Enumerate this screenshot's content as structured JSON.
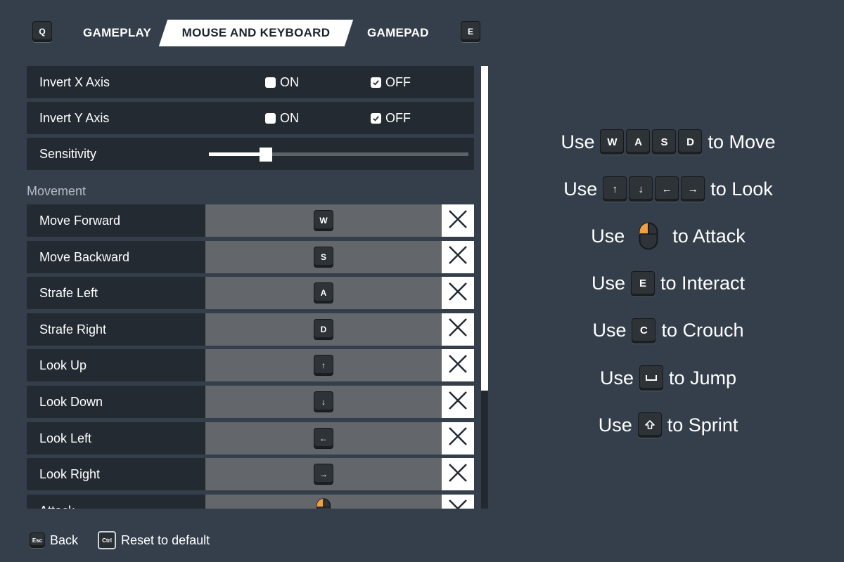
{
  "tabs": {
    "prev_key": "Q",
    "next_key": "E",
    "items": [
      {
        "label": "GAMEPLAY"
      },
      {
        "label": "MOUSE AND KEYBOARD",
        "active": true
      },
      {
        "label": "GAMEPAD"
      }
    ]
  },
  "settings": {
    "invert_x": {
      "label": "Invert X Axis",
      "on_label": "ON",
      "off_label": "OFF",
      "value": "OFF"
    },
    "invert_y": {
      "label": "Invert Y Axis",
      "on_label": "ON",
      "off_label": "OFF",
      "value": "OFF"
    },
    "sensitivity": {
      "label": "Sensitivity",
      "value_fraction": 0.22
    }
  },
  "movement": {
    "section_label": "Movement",
    "bindings": [
      {
        "action": "Move Forward",
        "key": "W",
        "icon": "w-key-icon"
      },
      {
        "action": "Move Backward",
        "key": "S",
        "icon": "s-key-icon"
      },
      {
        "action": "Strafe Left",
        "key": "A",
        "icon": "a-key-icon"
      },
      {
        "action": "Strafe Right",
        "key": "D",
        "icon": "d-key-icon"
      },
      {
        "action": "Look Up",
        "key": "↑",
        "icon": "arrow-up-key-icon"
      },
      {
        "action": "Look Down",
        "key": "↓",
        "icon": "arrow-down-key-icon"
      },
      {
        "action": "Look Left",
        "key": "←",
        "icon": "arrow-left-key-icon"
      },
      {
        "action": "Look Right",
        "key": "→",
        "icon": "arrow-right-key-icon"
      },
      {
        "action": "Attack",
        "key": "",
        "icon": "mouse-left-click-icon"
      }
    ]
  },
  "scroll": {
    "thumb_fraction": 0.733
  },
  "footer": {
    "back_key": "Esc",
    "back_label": "Back",
    "reset_key": "Ctrl",
    "reset_label": "Reset to default"
  },
  "hints": [
    {
      "prefix": "Use",
      "keys": [
        "W",
        "A",
        "S",
        "D"
      ],
      "suffix": "to Move"
    },
    {
      "prefix": "Use",
      "keys": [
        "↑",
        "↓",
        "←",
        "→"
      ],
      "suffix": "to Look"
    },
    {
      "prefix": "Use",
      "keys": [],
      "icon": "mouse-left-click-icon",
      "suffix": "to Attack"
    },
    {
      "prefix": "Use",
      "keys": [
        "E"
      ],
      "suffix": "to Interact"
    },
    {
      "prefix": "Use",
      "keys": [
        "C"
      ],
      "suffix": "to Crouch"
    },
    {
      "prefix": "Use",
      "keys": [],
      "icon": "space-key-icon",
      "suffix": "to Jump"
    },
    {
      "prefix": "Use",
      "keys": [],
      "icon": "shift-key-icon",
      "suffix": "to Sprint"
    }
  ],
  "colors": {
    "accent_mouse": "#f0a040",
    "background": "#353f4b",
    "row_dark": "#232a32",
    "row_binding": "#63676b"
  }
}
